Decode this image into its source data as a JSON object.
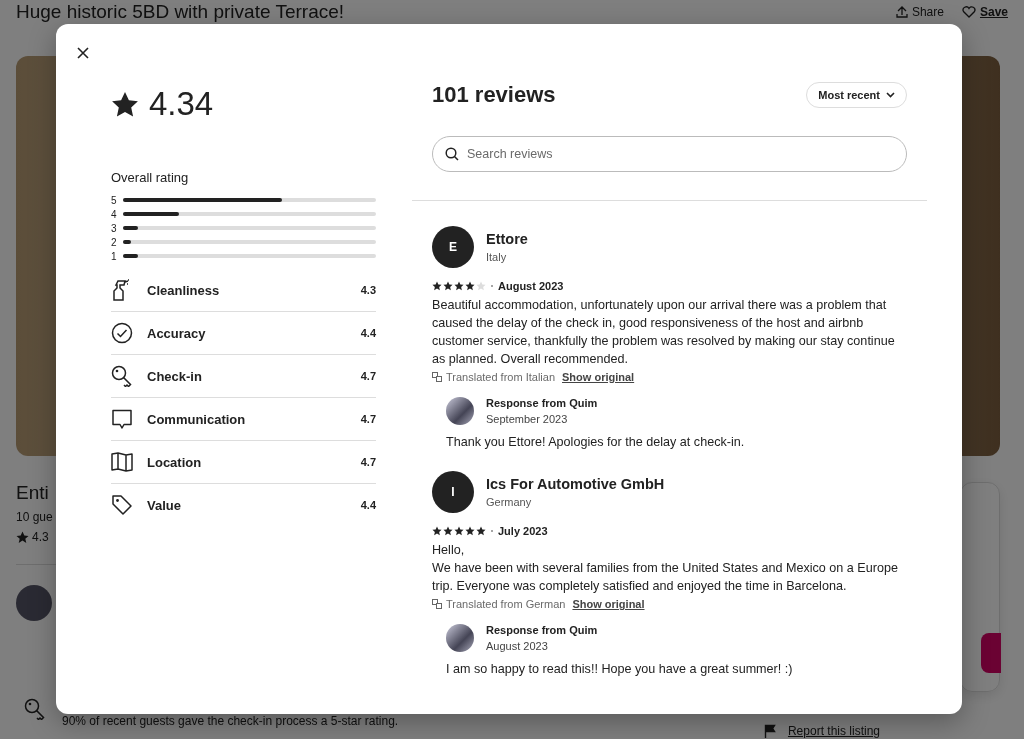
{
  "page": {
    "title": "Huge historic 5BD with private Terrace!",
    "share": "Share",
    "save": "Save",
    "heading": "Enti",
    "guests": "10 gue",
    "rating": "4.3",
    "checkin_note": "90% of recent guests gave the check-in process a 5-star rating.",
    "report": "Report this listing"
  },
  "rating": {
    "score": "4.34",
    "overall_label": "Overall rating",
    "histogram": [
      {
        "label": "5",
        "level": 0.63
      },
      {
        "label": "4",
        "level": 0.22
      },
      {
        "label": "3",
        "level": 0.06
      },
      {
        "label": "2",
        "level": 0.03
      },
      {
        "label": "1",
        "level": 0.06
      }
    ],
    "categories": [
      {
        "kind": "cleanliness",
        "label": "Cleanliness",
        "score": "4.3"
      },
      {
        "kind": "accuracy",
        "label": "Accuracy",
        "score": "4.4"
      },
      {
        "kind": "checkin",
        "label": "Check-in",
        "score": "4.7"
      },
      {
        "kind": "communication",
        "label": "Communication",
        "score": "4.7"
      },
      {
        "kind": "location",
        "label": "Location",
        "score": "4.7"
      },
      {
        "kind": "value",
        "label": "Value",
        "score": "4.4"
      }
    ]
  },
  "reviews_header": {
    "count": "101 reviews",
    "sort": "Most recent",
    "search_placeholder": "Search reviews"
  },
  "reviews": [
    {
      "initial": "E",
      "name": "Ettore",
      "location": "Italy",
      "stars": 4,
      "date": "August 2023",
      "text": "Beautiful accommodation, unfortunately upon our arrival there was a problem that caused the delay of the check in, good responsiveness of the host and airbnb customer service, thankfully the problem was resolved by making our stay continue as planned. Overall recommended.",
      "translated": "Translated from Italian",
      "show_original": "Show original",
      "response": {
        "title": "Response from Quim",
        "date": "September 2023",
        "text": "Thank you Ettore! Apologies for the delay at check-in."
      }
    },
    {
      "initial": "I",
      "name": "Ics For Automotive GmbH",
      "location": "Germany",
      "stars": 5,
      "date": "July 2023",
      "text": "Hello,\nWe have been with several families from the United States and Mexico on a Europe trip. Everyone was completely satisfied and enjoyed the time in Barcelona.",
      "translated": "Translated from German",
      "show_original": "Show original",
      "response": {
        "title": "Response from Quim",
        "date": "August 2023",
        "text": "I am so happy to read this!! Hope you have a great summer! :)"
      }
    }
  ]
}
